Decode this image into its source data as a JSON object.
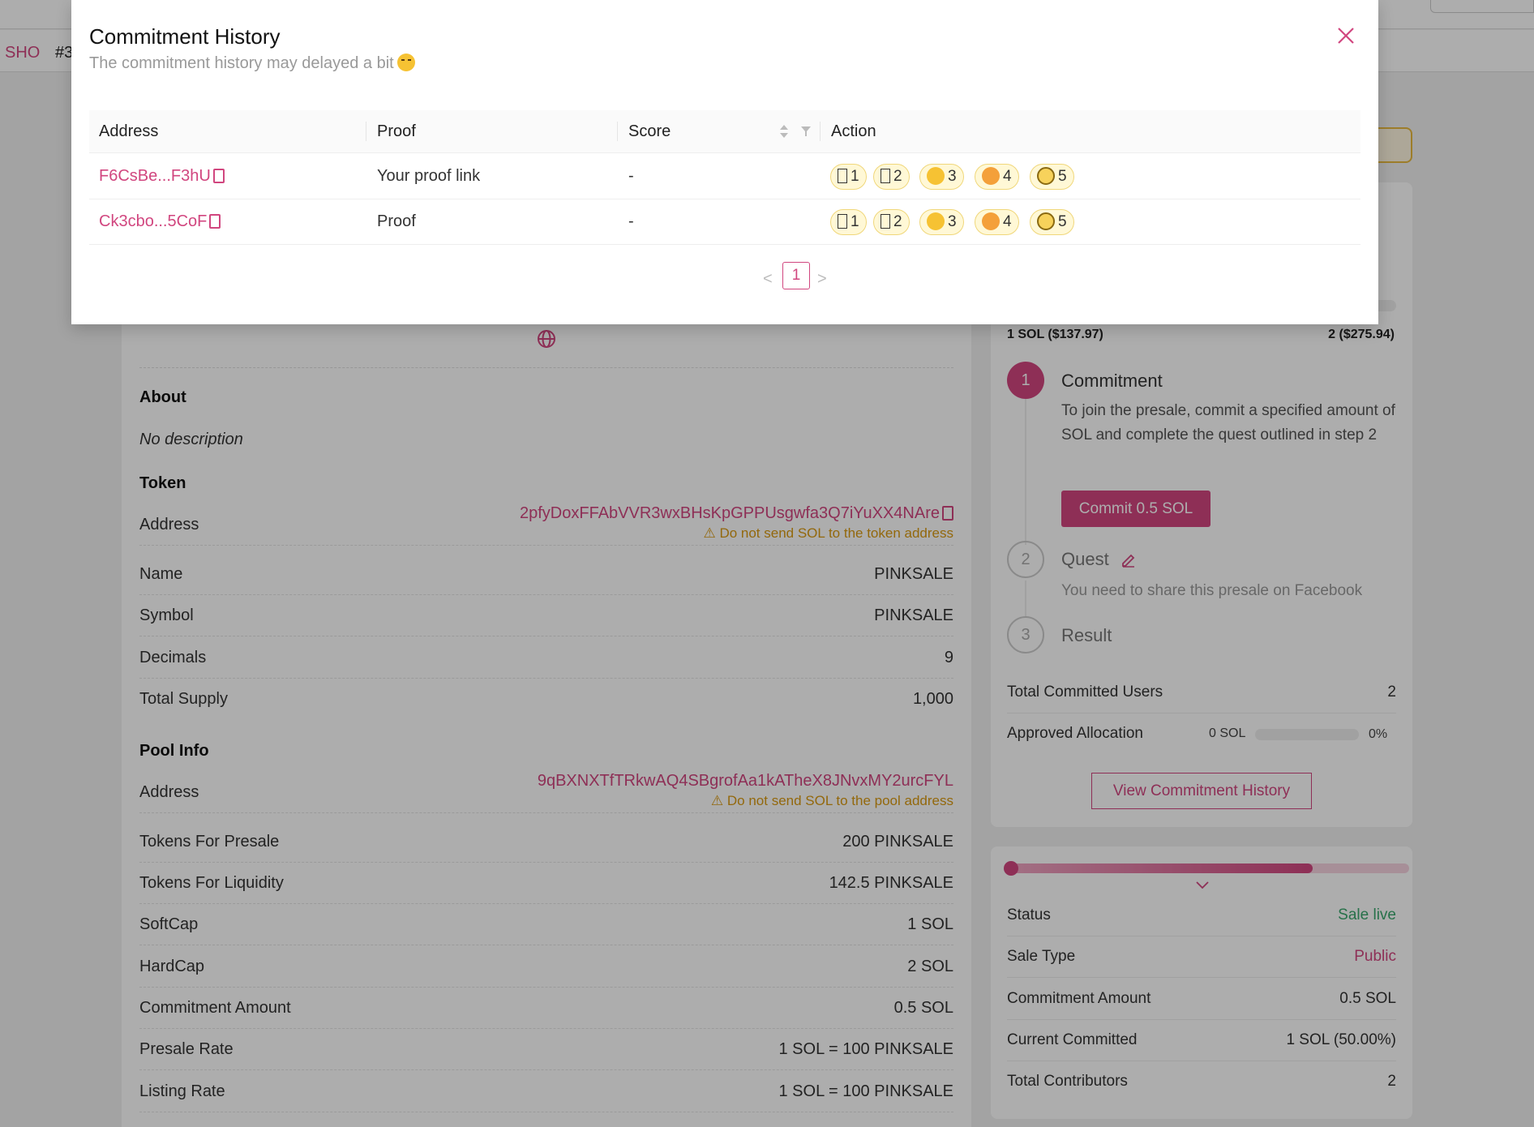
{
  "header": {
    "breadcrumb_sho": "SHO",
    "breadcrumb_id": "#3"
  },
  "main": {
    "about_title": "About",
    "description": "No description",
    "token_title": "Token",
    "token_rows": [
      {
        "label": "Address",
        "value": "2pfyDoxFFAbVVR3wxBHsKpGPPUsgwfa3Q7iYuXX4NAre",
        "warning": "⚠ Do not send SOL to the token address"
      },
      {
        "label": "Name",
        "value": "PINKSALE"
      },
      {
        "label": "Symbol",
        "value": "PINKSALE"
      },
      {
        "label": "Decimals",
        "value": "9"
      },
      {
        "label": "Total Supply",
        "value": "1,000"
      }
    ],
    "pool_title": "Pool Info",
    "pool_rows": [
      {
        "label": "Address",
        "value": "9qBXNXTfTRkwAQ4SBgrofAa1kATheX8JNvxMY2urcFYL",
        "warning": "⚠ Do not send SOL to the pool address"
      },
      {
        "label": "Tokens For Presale",
        "value": "200 PINKSALE"
      },
      {
        "label": "Tokens For Liquidity",
        "value": "142.5 PINKSALE"
      },
      {
        "label": "SoftCap",
        "value": "1 SOL"
      },
      {
        "label": "HardCap",
        "value": "2 SOL"
      },
      {
        "label": "Commitment Amount",
        "value": "0.5 SOL"
      },
      {
        "label": "Presale Rate",
        "value": "1 SOL = 100 PINKSALE"
      },
      {
        "label": "Listing Rate",
        "value": "1 SOL = 100 PINKSALE"
      }
    ]
  },
  "sidebar": {
    "soft_label": "1 SOL ($137.97)",
    "hard_label": "2 ($275.94)",
    "steps": [
      {
        "num": "1",
        "title": "Commitment",
        "desc": "To join the presale, commit a specified amount of SOL and complete the quest outlined in step 2"
      },
      {
        "num": "2",
        "title": "Quest",
        "desc": "You need to share this presale on Facebook"
      },
      {
        "num": "3",
        "title": "Result"
      }
    ],
    "commit_button": "Commit 0.5 SOL",
    "total_committed_users_label": "Total Committed Users",
    "total_committed_users_value": "2",
    "approved_allocation_label": "Approved Allocation",
    "approved_allocation_sol": "0 SOL",
    "approved_allocation_pct": "0%",
    "approved_allocation_fraction": 0,
    "view_history_button": "View Commitment History",
    "sale_progress_fraction": 0.76,
    "status_rows": [
      {
        "label": "Status",
        "value": "Sale live",
        "color": "#3aa76d"
      },
      {
        "label": "Sale Type",
        "value": "Public",
        "color": "#d1467f"
      },
      {
        "label": "Commitment Amount",
        "value": "0.5 SOL"
      },
      {
        "label": "Current Committed",
        "value": "1 SOL (50.00%)"
      },
      {
        "label": "Total Contributors",
        "value": "2"
      }
    ]
  },
  "modal": {
    "title": "Commitment History",
    "subtitle": "The commitment history may delayed a bit",
    "columns": {
      "address": "Address",
      "proof": "Proof",
      "score": "Score",
      "action": "Action"
    },
    "rows": [
      {
        "address": "F6CsBe...F3hU",
        "proof": "Your proof link",
        "score": "-"
      },
      {
        "address": "Ck3cbo...5CoF",
        "proof": "Proof",
        "score": "-"
      }
    ],
    "action_scores": [
      "1",
      "2",
      "3",
      "4",
      "5"
    ],
    "pagination": {
      "prev": "<",
      "current": "1",
      "next": ">"
    }
  },
  "colors": {
    "accent": "#d1467f",
    "warning": "#d99a12",
    "success": "#3aa76d"
  }
}
